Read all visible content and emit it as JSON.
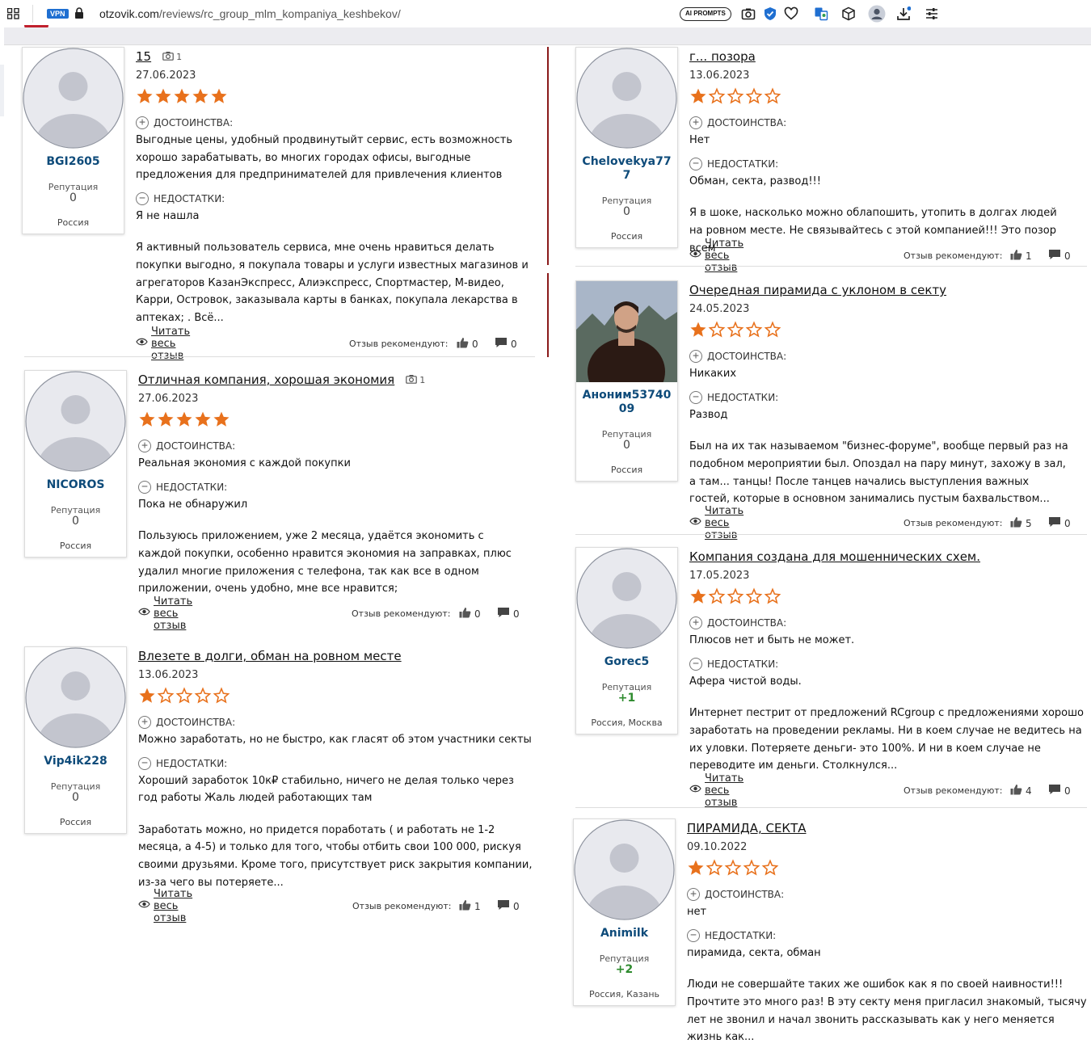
{
  "browser": {
    "vpn_label": "VPN",
    "url_host": "otzovik.com",
    "url_path": "/reviews/rc_group_mlm_kompaniya_keshbekov/",
    "ai_prompts_label": "AI PROMPTS"
  },
  "labels": {
    "pros": "ДОСТОИНСТВА:",
    "cons": "НЕДОСТАТКИ:",
    "read_full": "Читать весь отзыв",
    "recommend": "Отзыв рекомендуют:",
    "reputation": "Репутация"
  },
  "reviews": [
    {
      "user": "BGI2605",
      "reputation": "0",
      "location": "Россия",
      "title": "15",
      "photos": "1",
      "date": "27.06.2023",
      "stars": 5,
      "pros": "Выгодные цены, удобный продвинутыйт сервис, есть возможность хорошо зарабатывать, во многих городах офисы, выгодные предложения для предпринимателей для привлечения клиентов",
      "cons": "Я не нашла",
      "body": "Я активный пользователь сервиса, мне очень нравиться делать покупки выгодно, я покупала товары и услуги известных магазинов и агрегаторов КазанЭкспресс, Алиэкспресс, Спортмастер, М-видео, Карри, Островок, заказывала карты в банках, покупала лекарства в аптеках; . Всё...",
      "likes": "0",
      "comments": "0"
    },
    {
      "user": "NICOROS",
      "reputation": "0",
      "location": "Россия",
      "title": "Отличная компания, хорошая экономия",
      "photos": "1",
      "date": "27.06.2023",
      "stars": 5,
      "pros": "Реальная экономия с каждой покупки",
      "cons": "Пока не обнаружил",
      "body": "Пользуюсь приложением, уже 2 месяца, удаётся экономить с каждой покупки, особенно нравится экономия на заправках, плюс удалил многие приложения с телефона, так как все в одном приложении, очень удобно, мне все нравится;",
      "likes": "0",
      "comments": "0"
    },
    {
      "user": "Vip4ik228",
      "reputation": "0",
      "location": "Россия",
      "title": "Влезете в долги, обман на ровном месте",
      "photos": "",
      "date": "13.06.2023",
      "stars": 1,
      "pros": "Можно заработать, но не быстро, как гласят об этом участники секты",
      "cons": "Хороший заработок 10к₽ стабильно, ничего не делая только через год работы Жаль людей работающих там",
      "body": "Заработать можно, но придется поработать ( и работать не 1-2 месяца, а 4-5) и только для того, чтобы отбить свои 100 000, рискуя своими друзьями. Кроме того, присутствует риск закрытия компании, из-за чего вы потеряете...",
      "likes": "1",
      "comments": "0"
    },
    {
      "user": "Chelovekya777",
      "reputation": "0",
      "location": "Россия",
      "title": "г... позора",
      "photos": "",
      "date": "13.06.2023",
      "stars": 1,
      "pros": "Нет",
      "cons": "Обман, секта, развод!!!",
      "body": "Я в шоке, насколько можно облапошить, утопить в долгах людей на ровном месте. Не связывайтесь с этой компанией!!! Это позор всем",
      "likes": "1",
      "comments": "0"
    },
    {
      "user": "Аноним5374009",
      "reputation": "0",
      "location": "Россия",
      "title": "Очередная пирамида с уклоном в секту",
      "photos": "",
      "date": "24.05.2023",
      "stars": 1,
      "pros": "Никаких",
      "cons": "Развод",
      "body": "Был на их так называемом \"бизнес-форуме\", вообще первый раз на подобном мероприятии был. Опоздал на пару минут, захожу в зал, а там... танцы! После танцев начались выступления важных гостей, которые в основном занимались пустым бахвальством...",
      "likes": "5",
      "comments": "0"
    },
    {
      "user": "Gorec5",
      "reputation": "+1",
      "location": "Россия, Москва",
      "title": "Компания создана для мошеннических схем.",
      "photos": "",
      "date": "17.05.2023",
      "stars": 1,
      "pros": "Плюсов нет и быть не может.",
      "cons": "Афера чистой воды.",
      "body": "Интернет пестрит от предложений RCgroup с предложениями хорошо заработать на проведении рекламы. Ни в коем случае не ведитесь на их уловки. Потеряете деньги- это 100%. И ни в коем случае не переводите им деньги. Столкнулся...",
      "likes": "4",
      "comments": "0"
    },
    {
      "user": "Animilk",
      "reputation": "+2",
      "location": "Россия, Казань",
      "title": "ПИРАМИДА, СЕКТА",
      "photos": "",
      "date": "09.10.2022",
      "stars": 1,
      "pros": "нет",
      "cons": "пирамида, секта, обман",
      "body": "Люди не совершайте таких же ошибок как я по своей наивности!!! Прочтите это много раз! В эту секту меня пригласил знакомый, тысячу лет не звонил и начал звонить рассказывать как у него меняется жизнь как...",
      "likes": "",
      "comments": ""
    }
  ]
}
